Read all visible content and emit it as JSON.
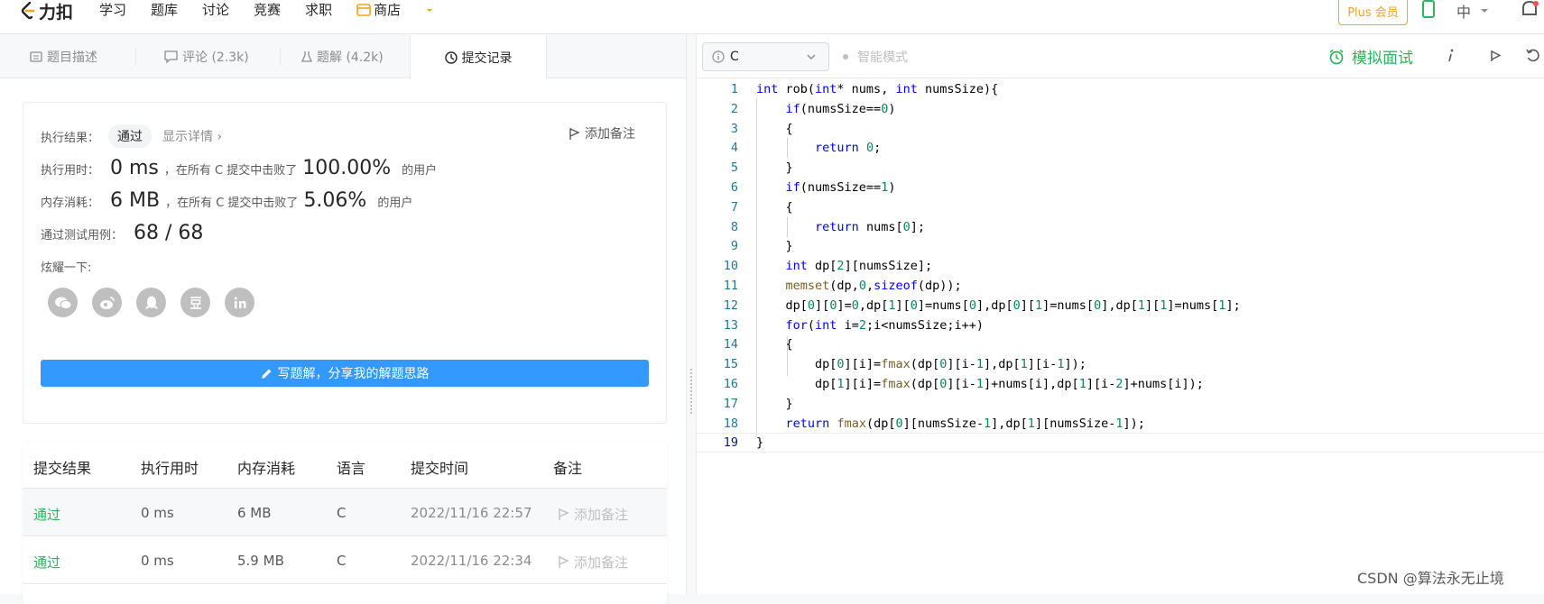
{
  "brand": {
    "name": "力扣"
  },
  "nav": {
    "items": [
      "学习",
      "题库",
      "讨论",
      "竞赛",
      "求职"
    ],
    "shop": "商店"
  },
  "header_right": {
    "plus": "Plus 会员",
    "lang": "中"
  },
  "tabs": {
    "desc": "题目描述",
    "comments": "评论 (2.3k)",
    "solutions": "题解 (4.2k)",
    "submissions": "提交记录"
  },
  "result": {
    "label_result": "执行结果：",
    "status": "通过",
    "detail": "显示详情 ›",
    "add_note": "添加备注",
    "label_time": "执行用时：",
    "time_value": "0 ms",
    "time_text": "，在所有 C 提交中击败了",
    "time_pct": "100.00%",
    "users": "的用户",
    "label_mem": "内存消耗：",
    "mem_value": "6 MB",
    "mem_text": "，在所有 C 提交中击败了",
    "mem_pct": "5.06%",
    "label_tests": "通过测试用例：",
    "tests": "68 / 68",
    "share_label": "炫耀一下:",
    "share_icons": [
      "wechat-icon",
      "weibo-icon",
      "qq-icon",
      "douban-icon",
      "linkedin-icon"
    ],
    "write_btn": "写题解，分享我的解题思路"
  },
  "table": {
    "headers": [
      "提交结果",
      "执行用时",
      "内存消耗",
      "语言",
      "提交时间",
      "备注"
    ],
    "rows": [
      {
        "status": "通过",
        "time": "0 ms",
        "memory": "6 MB",
        "lang": "C",
        "submitted": "2022/11/16 22:57",
        "note": "添加备注"
      },
      {
        "status": "通过",
        "time": "0 ms",
        "memory": "5.9 MB",
        "lang": "C",
        "submitted": "2022/11/16 22:34",
        "note": "添加备注"
      }
    ]
  },
  "editor_bar": {
    "language": "C",
    "smart_mode": "智能模式",
    "mock": "模拟面试"
  },
  "code_lines": [
    "int rob(int* nums, int numsSize){",
    "    if(numsSize==0)",
    "    {",
    "        return 0;",
    "    }",
    "    if(numsSize==1)",
    "    {",
    "        return nums[0];",
    "    }",
    "    int dp[2][numsSize];",
    "    memset(dp,0,sizeof(dp));",
    "    dp[0][0]=0,dp[1][0]=nums[0],dp[0][1]=nums[0],dp[1][1]=nums[1];",
    "    for(int i=2;i<numsSize;i++)",
    "    {",
    "        dp[0][i]=fmax(dp[0][i-1],dp[1][i-1]);",
    "        dp[1][i]=fmax(dp[0][i-1]+nums[i],dp[1][i-2]+nums[i]);",
    "    }",
    "    return fmax(dp[0][numsSize-1],dp[1][numsSize-1]);",
    "}"
  ],
  "watermark": "CSDN @算法永无止境",
  "colors": {
    "accent": "#ffa116",
    "pass": "#2db55d",
    "button": "#3399ff"
  }
}
